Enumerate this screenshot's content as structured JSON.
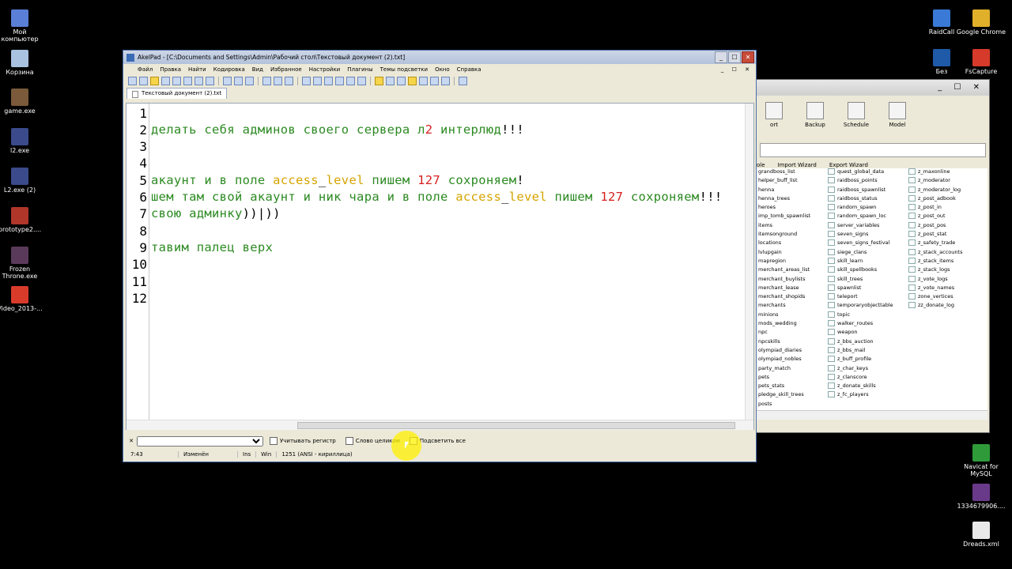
{
  "desktop": {
    "left_icons": [
      {
        "label": "Мой компьютер",
        "color": "#5a7fd6"
      },
      {
        "label": "Корзина",
        "color": "#a9c2e0"
      },
      {
        "label": "game.exe",
        "color": "#7a5a3a"
      },
      {
        "label": "l2.exe",
        "color": "#3a4a8a"
      },
      {
        "label": "L2.exe (2)",
        "color": "#3a4a8a"
      },
      {
        "label": "prototype2....",
        "color": "#b0362a"
      },
      {
        "label": "Frozen Throne.exe",
        "color": "#5a3a5a"
      },
      {
        "label": "Video_2013-...",
        "color": "#d93b2b"
      }
    ],
    "right_icons": [
      {
        "label": "RaidCall",
        "color": "#3a7ad6"
      },
      {
        "label": "Google Chrome",
        "color": "#e0b02a"
      },
      {
        "label": "Без",
        "color": "#1f5aa8"
      },
      {
        "label": "FsCapture",
        "color": "#d63a2a"
      },
      {
        "label": "Navicat for MySQL",
        "color": "#2f9a3a"
      },
      {
        "label": "1334679906....",
        "color": "#6a3a8a"
      },
      {
        "label": "Dreads.xml",
        "color": "#eaeaea"
      }
    ]
  },
  "navicat": {
    "toolbar": [
      "ort",
      "Backup",
      "Schedule",
      "Model"
    ],
    "bar2": [
      "ole",
      "Import Wizard",
      "Export Wizard"
    ],
    "col1": [
      "grandboss_list",
      "helper_buff_list",
      "henna",
      "henna_trees",
      "heroes",
      "imp_tomb_spawnlist",
      "items",
      "itemsonground",
      "locations",
      "lvlupgain",
      "mapregion",
      "merchant_areas_list",
      "merchant_buylists",
      "merchant_lease",
      "merchant_shopids",
      "merchants",
      "minions",
      "mods_wedding",
      "npc",
      "npcskills",
      "olympiad_diaries",
      "olympiad_nobles",
      "party_match",
      "pets",
      "pets_stats",
      "pledge_skill_trees",
      "posts"
    ],
    "col2": [
      "quest_global_data",
      "raidboss_points",
      "raidboss_spawnlist",
      "raidboss_status",
      "random_spawn",
      "random_spawn_loc",
      "server_variables",
      "seven_signs",
      "seven_signs_festival",
      "siege_clans",
      "skill_learn",
      "skill_spellbooks",
      "skill_trees",
      "spawnlist",
      "teleport",
      "temporaryobjecttable",
      "topic",
      "walker_routes",
      "weapon",
      "z_bbs_auction",
      "z_bbs_mail",
      "z_buff_profile",
      "z_char_keys",
      "z_clanscore",
      "z_donate_skills",
      "z_fc_players"
    ],
    "col3": [
      "z_maxonline",
      "z_moderator",
      "z_moderator_log",
      "z_post_adbook",
      "z_post_in",
      "z_post_out",
      "z_post_pos",
      "z_post_stat",
      "z_safety_trade",
      "z_stack_accounts",
      "z_stack_items",
      "z_stack_logs",
      "z_vote_logs",
      "z_vote_names",
      "zone_vertices",
      "zz_donate_log"
    ]
  },
  "akelpad": {
    "title": "AkelPad - [C:\\Documents and Settings\\Admin\\Рабочий стол\\Текстовый документ (2).txt]",
    "menu": [
      "Файл",
      "Правка",
      "Найти",
      "Кодировка",
      "Вид",
      "Избранное",
      "Настройки",
      "Плагины",
      "Темы подсветки",
      "Окно",
      "Справка"
    ],
    "tab": "Текстовый документ (2).txt",
    "line_numbers": [
      "1",
      "2",
      "3",
      "4",
      "5",
      "6",
      "7",
      "8",
      "9",
      "10",
      "11",
      "12"
    ],
    "lines": {
      "l2a": "делать себя админов своего сервера л",
      "l2b": "2",
      "l2c": " интерлюд",
      "l2d": "!!!",
      "l5a": "акаунт и в поле ",
      "l5b": "access",
      "l5c": "_",
      "l5d": "level",
      "l5e": " пишем ",
      "l5f": "127",
      "l5g": " сохроняем",
      "l5h": "!",
      "l6a": "шем там свой акаунт и ник чара и в поле ",
      "l6b": "access",
      "l6c": "_",
      "l6d": "level",
      "l6e": " пишем ",
      "l6f": "127",
      "l6g": " сохроняем",
      "l6h": "!!!",
      "l7a": "свою админку",
      "l7b": "))|))",
      "l9a": "тавим палец верх"
    },
    "find": {
      "match_case": "Учитывать регистр",
      "whole_word": "Слово целиком",
      "highlight_all": "Подсветить все"
    },
    "status": {
      "position": "7:43",
      "modified": "Изменён",
      "ins": "Ins",
      "eol": "Win",
      "encoding": "1251  (ANSI - кириллица)"
    }
  }
}
